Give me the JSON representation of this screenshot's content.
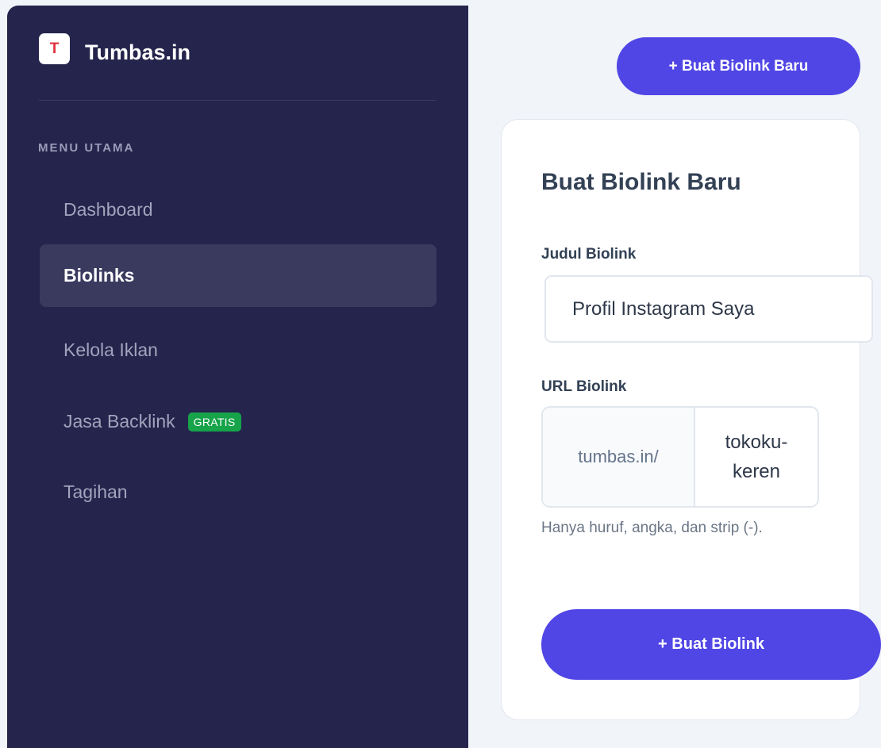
{
  "brand": {
    "logo_letter": "T",
    "name": "Tumbas.in"
  },
  "sidebar": {
    "section_label": "MENU UTAMA",
    "items": [
      {
        "label": "Dashboard",
        "active": false
      },
      {
        "label": "Biolinks",
        "active": true
      },
      {
        "label": "Kelola Iklan",
        "active": false
      },
      {
        "label": "Jasa Backlink",
        "active": false,
        "badge": "GRATIS"
      },
      {
        "label": "Tagihan",
        "active": false
      }
    ]
  },
  "header": {
    "new_button_label": "+ Buat Biolink Baru"
  },
  "form": {
    "title": "Buat Biolink Baru",
    "title_field": {
      "label": "Judul Biolink",
      "value": "Profil Instagram Saya"
    },
    "url_field": {
      "label": "URL Biolink",
      "prefix": "tumbas.in/",
      "value": "tokoku-keren"
    },
    "hint": "Hanya huruf, angka, dan strip (-).",
    "submit_label": "+ Buat Biolink"
  },
  "colors": {
    "sidebar_bg": "#24244c",
    "active_item_bg": "#3a3a5f",
    "primary": "#5046e5",
    "badge_green": "#16a34a",
    "logo_red": "#e0323c",
    "page_bg": "#f1f4f9"
  }
}
